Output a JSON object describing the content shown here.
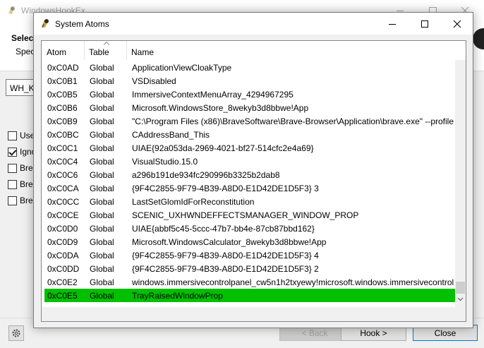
{
  "background": {
    "title": "WindowsHookEx",
    "header_title": "Selec",
    "header_sub": "Spec",
    "combo_value": "WH_K",
    "checkboxes": [
      {
        "label": "Use",
        "checked": false
      },
      {
        "label": "Igno",
        "checked": true
      },
      {
        "label": "Brea",
        "checked": false
      },
      {
        "label": "Brea",
        "checked": false
      },
      {
        "label": "Brea",
        "checked": false
      }
    ],
    "buttons": {
      "back": "< Back",
      "hook": "Hook >",
      "close": "Close"
    }
  },
  "dialog": {
    "title": "System Atoms",
    "controls": {
      "minimize": "minimize-icon",
      "maximize": "maximize-icon",
      "close": "close-icon"
    },
    "columns": [
      "Atom",
      "Table",
      "Name"
    ],
    "sort_column": "Table",
    "selected_color": "#00c000",
    "rows": [
      {
        "atom": "0xC0AD",
        "table": "Global",
        "name": "ApplicationViewCloakType"
      },
      {
        "atom": "0xC0B1",
        "table": "Global",
        "name": "VSDisabled"
      },
      {
        "atom": "0xC0B5",
        "table": "Global",
        "name": "ImmersiveContextMenuArray_4294967295"
      },
      {
        "atom": "0xC0B6",
        "table": "Global",
        "name": "Microsoft.WindowsStore_8wekyb3d8bbwe!App"
      },
      {
        "atom": "0xC0B9",
        "table": "Global",
        "name": "\"C:\\Program Files (x86)\\BraveSoftware\\Brave-Browser\\Application\\brave.exe\" --profile"
      },
      {
        "atom": "0xC0BC",
        "table": "Global",
        "name": "CAddressBand_This"
      },
      {
        "atom": "0xC0C1",
        "table": "Global",
        "name": "UIAE{92a053da-2969-4021-bf27-514cfc2e4a69}"
      },
      {
        "atom": "0xC0C4",
        "table": "Global",
        "name": "VisualStudio.15.0"
      },
      {
        "atom": "0xC0C6",
        "table": "Global",
        "name": "a296b191de934fc290996b3325b2dab8"
      },
      {
        "atom": "0xC0CA",
        "table": "Global",
        "name": "{9F4C2855-9F79-4B39-A8D0-E1D42DE1D5F3} 3"
      },
      {
        "atom": "0xC0CC",
        "table": "Global",
        "name": "LastSetGlomIdForReconstitution"
      },
      {
        "atom": "0xC0CE",
        "table": "Global",
        "name": "SCENIC_UXHWNDEFFECTSMANAGER_WINDOW_PROP"
      },
      {
        "atom": "0xC0D0",
        "table": "Global",
        "name": "UIAE{abbf5c45-5ccc-47b7-bb4e-87cb87bbd162}"
      },
      {
        "atom": "0xC0D9",
        "table": "Global",
        "name": "Microsoft.WindowsCalculator_8wekyb3d8bbwe!App"
      },
      {
        "atom": "0xC0DA",
        "table": "Global",
        "name": "{9F4C2855-9F79-4B39-A8D0-E1D42DE1D5F3} 4"
      },
      {
        "atom": "0xC0DD",
        "table": "Global",
        "name": "{9F4C2855-9F79-4B39-A8D0-E1D42DE1D5F3} 2"
      },
      {
        "atom": "0xC0E2",
        "table": "Global",
        "name": "windows.immersivecontrolpanel_cw5n1h2txyewy!microsoft.windows.immersivecontrol"
      },
      {
        "atom": "0xC0E5",
        "table": "Global",
        "name": "TrayRaisedWindowProp",
        "selected": true
      }
    ]
  }
}
